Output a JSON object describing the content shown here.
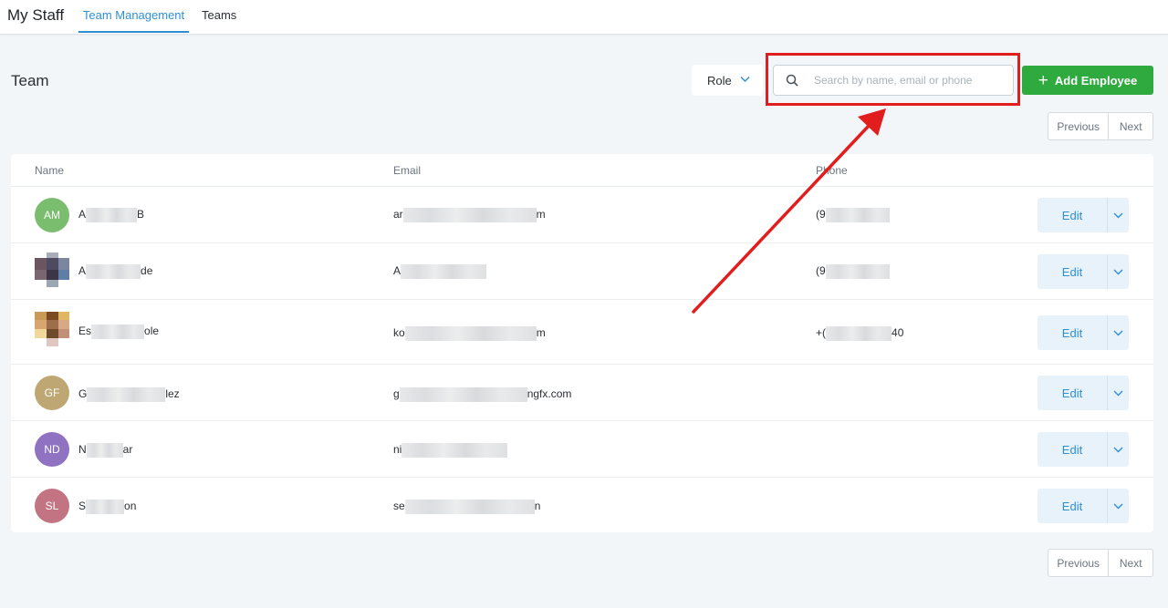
{
  "nav": {
    "brand": "My Staff",
    "tabs": [
      {
        "label": "Team Management",
        "active": true
      },
      {
        "label": "Teams",
        "active": false
      }
    ]
  },
  "page": {
    "title": "Team"
  },
  "toolbar": {
    "role_label": "Role",
    "search_placeholder": "Search by name, email or phone",
    "add_label": "Add Employee"
  },
  "pagination": {
    "previous": "Previous",
    "next": "Next"
  },
  "table": {
    "headers": {
      "name": "Name",
      "email": "Email",
      "phone": "Phone"
    },
    "edit_label": "Edit",
    "rows": [
      {
        "initials": "AM",
        "avatar_color": "#7bbd6f",
        "name_start": "A",
        "name_end": "B",
        "email_start": "ar",
        "email_end": "m",
        "phone_start": "(9",
        "phone_end": ""
      },
      {
        "initials": "",
        "avatar_color": "",
        "name_start": "A",
        "name_end": "de",
        "email_start": "A",
        "email_end": "",
        "phone_start": "(9",
        "phone_end": ""
      },
      {
        "initials": "",
        "avatar_color": "",
        "name_start": "Es",
        "name_end": "ole",
        "email_start": "ko",
        "email_end": "m",
        "phone_start": "+(",
        "phone_end": "40"
      },
      {
        "initials": "GF",
        "avatar_color": "#bfa774",
        "name_start": "G",
        "name_end": "lez",
        "email_start": "g",
        "email_end": "ngfx.com",
        "phone_start": "",
        "phone_end": ""
      },
      {
        "initials": "ND",
        "avatar_color": "#8f72c1",
        "name_start": "N",
        "name_end": "ar",
        "email_start": "ni",
        "email_end": "",
        "phone_start": "",
        "phone_end": ""
      },
      {
        "initials": "SL",
        "avatar_color": "#c27482",
        "name_start": "S",
        "name_end": "on",
        "email_start": "se",
        "email_end": "n",
        "phone_start": "",
        "phone_end": ""
      }
    ]
  },
  "icons": {
    "search": "search-icon",
    "chevron": "chevron-down-icon",
    "plus": "plus-icon"
  },
  "colors": {
    "accent": "#2f8fd6",
    "add_button": "#2eaa3f",
    "annotation": "#e11d1d"
  }
}
